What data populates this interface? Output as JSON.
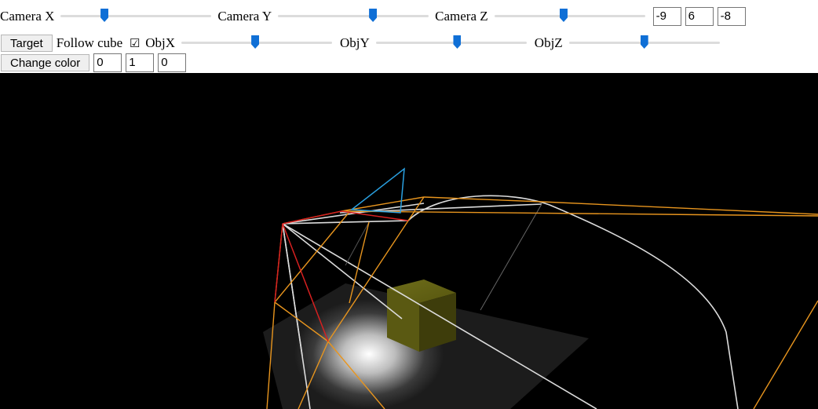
{
  "controls": {
    "camera_x_label": "Camera X",
    "camera_y_label": "Camera Y",
    "camera_z_label": "Camera Z",
    "camera_values": [
      "-9",
      "6",
      "-8"
    ],
    "target_button": "Target",
    "follow_label": "Follow cube",
    "follow_checked": true,
    "follow_checkbox_symbol": "☑",
    "objx_label": "ObjX",
    "objy_label": "ObjY",
    "objz_label": "ObjZ",
    "change_color_button": "Change color",
    "color_values": [
      "0",
      "1",
      "0"
    ]
  },
  "sliders": {
    "camera_x": 0.29,
    "camera_y": 0.63,
    "camera_z": 0.46,
    "objx": 0.49,
    "objy": 0.54,
    "objz": 0.5
  },
  "scene": {
    "background": "#000000",
    "cube_color": "#6b6a18",
    "helper_orange": "#e8951e",
    "helper_red": "#d62020",
    "helper_blue": "#2aa0e0",
    "helper_white": "#e0e0e0"
  }
}
